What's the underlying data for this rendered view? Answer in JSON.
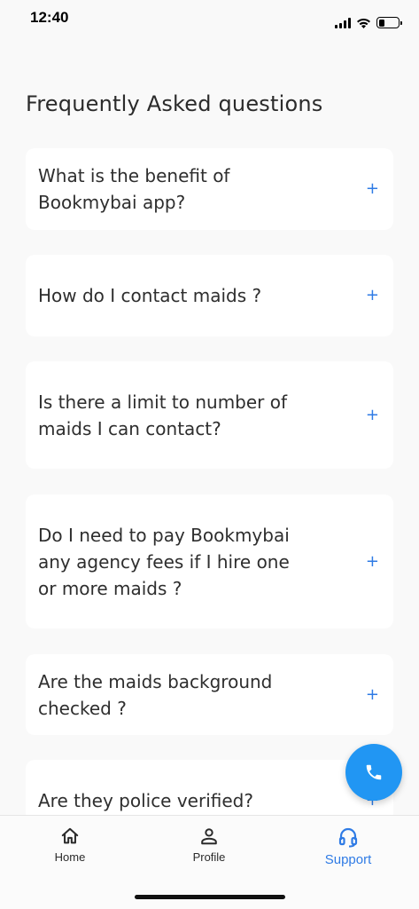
{
  "status_bar": {
    "time": "12:40"
  },
  "title": "Frequently Asked questions",
  "faq": [
    {
      "question": "What is the benefit of Bookmybai app?",
      "icon": "+"
    },
    {
      "question": "How do I contact maids ?",
      "icon": "+"
    },
    {
      "question": "Is there a limit to number of maids I can contact?",
      "icon": "+"
    },
    {
      "question": "Do I need to pay Bookmybai any agency fees if I hire one or more maids ?",
      "icon": "+"
    },
    {
      "question": "Are the maids background checked ?",
      "icon": "+"
    },
    {
      "question": "Are they police verified?",
      "icon": "+"
    }
  ],
  "fab": {
    "icon": "phone-icon"
  },
  "nav": {
    "home": "Home",
    "profile": "Profile",
    "support": "Support"
  },
  "colors": {
    "accent": "#2f7be5",
    "fab": "#2196f3",
    "background": "#f9f9f9"
  }
}
